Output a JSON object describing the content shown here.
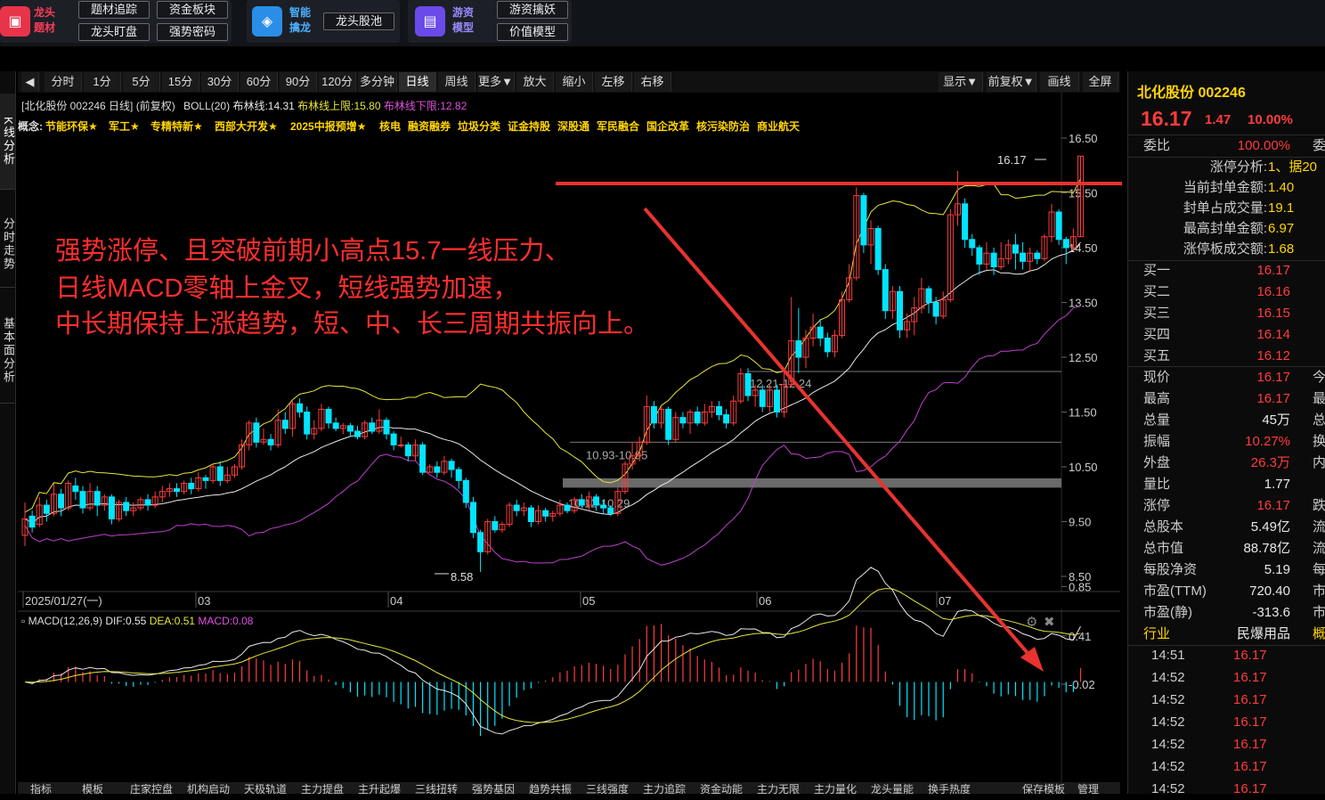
{
  "topbar": {
    "group1": {
      "title_line1": "龙头",
      "title_line2": "题材",
      "buttons": [
        "题材追踪",
        "资金板块",
        "龙头盯盘",
        "强势密码"
      ]
    },
    "group2": {
      "title_line1": "智能",
      "title_line2": "擒龙",
      "buttons": [
        "龙头股池"
      ]
    },
    "group3": {
      "title_line1": "游资",
      "title_line2": "模型",
      "buttons": [
        "游资擒妖",
        "价值模型"
      ]
    }
  },
  "left_rail": [
    "K线分析",
    "分时走势",
    "基本面分析"
  ],
  "toolbar": {
    "periods": [
      "分时",
      "1分",
      "5分",
      "15分",
      "30分",
      "60分",
      "90分",
      "120分",
      "多分钟",
      "日线",
      "周线",
      "更多▼",
      "放大",
      "缩小",
      "左移",
      "右移"
    ],
    "active": "日线",
    "right": [
      "显示▼",
      "前复权▼",
      "画线",
      "全屏"
    ]
  },
  "chart_header": {
    "title": "[北化股份 002246 日线] (前复权)",
    "boll_label": "BOLL(20)",
    "boll_mid": "布林线:14.31",
    "boll_upper": "布林线上限:15.80",
    "boll_lower": "布林线下限:12.82",
    "concepts_label": "概念:",
    "concepts": [
      "节能环保★",
      "军工★",
      "专精特新★",
      "西部大开发★",
      "2025中报预增★",
      "核电",
      "融资融券",
      "垃圾分类",
      "证金持股",
      "深股通",
      "军民融合",
      "国企改革",
      "核污染防治",
      "商业航天"
    ]
  },
  "annotation": [
    "强势涨停、且突破前期小高点15.7一线压力、",
    "日线MACD零轴上金叉，短线强势加速，",
    "中长期保持上涨趋势，短、中、长三周期共振向上。"
  ],
  "chart_data": {
    "type": "candlestick",
    "price_axis_ticks": [
      "16.50",
      "15.50",
      "14.50",
      "13.50",
      "12.50",
      "11.50",
      "10.50",
      "9.50",
      "8.50"
    ],
    "ylim": [
      8.5,
      16.5
    ],
    "date_labels": [
      "2025/01/27(一)",
      "03",
      "04",
      "05",
      "06",
      "07"
    ],
    "price_labels": [
      "16.17",
      "8.58",
      "12.21-12.24",
      "10.93-10.95",
      "10.12-10.29"
    ],
    "resistance_level": 15.7,
    "zones": [
      {
        "label": "12.21-12.24",
        "low": 12.21,
        "high": 12.24
      },
      {
        "label": "10.93-10.95",
        "low": 10.93,
        "high": 10.95
      },
      {
        "label": "10.12-10.29",
        "low": 10.12,
        "high": 10.29
      }
    ],
    "candles": [
      [
        9.25,
        9.55,
        9.85,
        9.05
      ],
      [
        9.6,
        9.4,
        9.7,
        9.3
      ],
      [
        9.45,
        9.8,
        9.95,
        9.4
      ],
      [
        9.8,
        9.65,
        9.9,
        9.5
      ],
      [
        9.65,
        10.0,
        10.2,
        9.6
      ],
      [
        10.0,
        9.75,
        10.1,
        9.6
      ],
      [
        9.75,
        10.2,
        10.25,
        9.7
      ],
      [
        10.15,
        10.05,
        10.3,
        9.9
      ],
      [
        10.05,
        9.75,
        10.15,
        9.65
      ],
      [
        9.75,
        10.05,
        10.2,
        9.7
      ],
      [
        10.05,
        9.8,
        10.15,
        9.6
      ],
      [
        9.8,
        9.95,
        10.0,
        9.7
      ],
      [
        9.95,
        9.55,
        10.0,
        9.45
      ],
      [
        9.55,
        9.85,
        9.9,
        9.5
      ],
      [
        9.85,
        9.7,
        9.95,
        9.6
      ],
      [
        9.7,
        9.75,
        9.85,
        9.6
      ],
      [
        9.75,
        9.9,
        9.95,
        9.7
      ],
      [
        9.9,
        9.8,
        10.0,
        9.7
      ],
      [
        9.8,
        9.95,
        10.05,
        9.75
      ],
      [
        9.95,
        10.05,
        10.15,
        9.85
      ],
      [
        10.05,
        10.1,
        10.2,
        9.95
      ],
      [
        10.1,
        10.05,
        10.2,
        9.95
      ],
      [
        10.05,
        10.2,
        10.25,
        10.0
      ],
      [
        10.2,
        10.1,
        10.3,
        10.0
      ],
      [
        10.1,
        10.3,
        10.4,
        10.05
      ],
      [
        10.3,
        10.25,
        10.35,
        10.1
      ],
      [
        10.25,
        10.5,
        10.55,
        10.2
      ],
      [
        10.5,
        10.25,
        10.6,
        10.15
      ],
      [
        10.25,
        10.35,
        10.5,
        10.2
      ],
      [
        10.35,
        10.5,
        10.55,
        10.3
      ],
      [
        10.5,
        10.9,
        11.0,
        10.45
      ],
      [
        10.9,
        11.3,
        11.35,
        10.8
      ],
      [
        11.3,
        10.95,
        11.4,
        10.85
      ],
      [
        10.95,
        11.0,
        11.2,
        10.9
      ],
      [
        11.0,
        10.9,
        11.1,
        10.8
      ],
      [
        10.9,
        11.35,
        11.55,
        10.85
      ],
      [
        11.35,
        11.2,
        11.5,
        11.1
      ],
      [
        11.2,
        11.65,
        11.7,
        11.05
      ],
      [
        11.65,
        11.5,
        11.75,
        11.4
      ],
      [
        11.5,
        11.1,
        11.6,
        11.0
      ],
      [
        11.1,
        11.2,
        11.35,
        11.0
      ],
      [
        11.2,
        11.55,
        11.65,
        11.15
      ],
      [
        11.55,
        11.3,
        11.6,
        11.2
      ],
      [
        11.3,
        11.2,
        11.4,
        11.15
      ],
      [
        11.2,
        11.25,
        11.3,
        11.1
      ],
      [
        11.25,
        11.15,
        11.3,
        11.05
      ],
      [
        11.15,
        11.05,
        11.25,
        11.0
      ],
      [
        11.05,
        11.3,
        11.35,
        11.0
      ],
      [
        11.3,
        11.15,
        11.4,
        11.1
      ],
      [
        11.15,
        11.35,
        11.55,
        11.1
      ],
      [
        11.35,
        11.1,
        11.4,
        11.0
      ],
      [
        11.1,
        10.9,
        11.15,
        10.8
      ],
      [
        10.9,
        10.9,
        11.05,
        10.85
      ],
      [
        10.9,
        10.7,
        10.95,
        10.6
      ],
      [
        10.7,
        10.9,
        11.0,
        10.6
      ],
      [
        10.9,
        10.4,
        10.95,
        10.35
      ],
      [
        10.4,
        10.5,
        10.55,
        10.4
      ],
      [
        10.5,
        10.4,
        10.6,
        10.3
      ],
      [
        10.4,
        10.6,
        10.7,
        10.35
      ],
      [
        10.6,
        10.45,
        10.65,
        10.3
      ],
      [
        10.45,
        10.25,
        10.5,
        10.1
      ],
      [
        10.25,
        9.85,
        10.3,
        9.75
      ],
      [
        9.85,
        9.3,
        9.95,
        9.2
      ],
      [
        9.3,
        8.95,
        9.35,
        8.58
      ],
      [
        8.95,
        9.5,
        9.55,
        8.9
      ],
      [
        9.5,
        9.35,
        9.6,
        9.3
      ],
      [
        9.35,
        9.45,
        9.5,
        9.3
      ],
      [
        9.45,
        9.8,
        9.85,
        9.4
      ],
      [
        9.8,
        9.7,
        9.9,
        9.6
      ],
      [
        9.7,
        9.75,
        9.85,
        9.6
      ],
      [
        9.75,
        9.5,
        9.8,
        9.4
      ],
      [
        9.5,
        9.7,
        9.8,
        9.45
      ],
      [
        9.7,
        9.6,
        9.75,
        9.5
      ],
      [
        9.6,
        9.65,
        9.7,
        9.5
      ],
      [
        9.65,
        9.8,
        9.9,
        9.6
      ],
      [
        9.8,
        9.7,
        9.85,
        9.65
      ],
      [
        9.7,
        9.9,
        9.95,
        9.65
      ],
      [
        9.9,
        9.8,
        10.0,
        9.75
      ],
      [
        9.8,
        9.95,
        10.05,
        9.7
      ],
      [
        9.95,
        9.8,
        10.0,
        9.7
      ],
      [
        9.8,
        9.75,
        9.9,
        9.65
      ],
      [
        9.75,
        9.65,
        9.8,
        9.6
      ],
      [
        9.65,
        10.05,
        10.12,
        9.6
      ],
      [
        10.05,
        10.55,
        10.6,
        10.0
      ],
      [
        10.55,
        10.7,
        10.95,
        10.45
      ],
      [
        10.7,
        10.95,
        11.05,
        10.6
      ],
      [
        10.95,
        11.6,
        11.8,
        10.9
      ],
      [
        11.6,
        11.3,
        11.7,
        11.2
      ],
      [
        11.3,
        11.55,
        11.6,
        11.2
      ],
      [
        11.55,
        11.0,
        11.6,
        10.9
      ],
      [
        11.0,
        11.4,
        11.5,
        10.95
      ],
      [
        11.4,
        11.3,
        11.5,
        11.2
      ],
      [
        11.3,
        11.5,
        11.55,
        11.1
      ],
      [
        11.5,
        11.3,
        11.6,
        11.25
      ],
      [
        11.3,
        11.5,
        11.65,
        11.25
      ],
      [
        11.5,
        11.6,
        11.7,
        11.4
      ],
      [
        11.6,
        11.45,
        11.7,
        11.35
      ],
      [
        11.45,
        11.3,
        11.55,
        11.2
      ],
      [
        11.3,
        11.7,
        11.8,
        11.25
      ],
      [
        11.7,
        12.2,
        12.3,
        11.65
      ],
      [
        12.2,
        11.8,
        12.3,
        11.7
      ],
      [
        11.8,
        11.9,
        12.0,
        11.6
      ],
      [
        11.9,
        11.6,
        12.0,
        11.5
      ],
      [
        11.6,
        11.9,
        12.0,
        11.5
      ],
      [
        11.9,
        11.5,
        12.0,
        11.4
      ],
      [
        11.5,
        12.0,
        12.24,
        11.4
      ],
      [
        12.0,
        12.8,
        13.6,
        11.95
      ],
      [
        12.8,
        12.5,
        13.4,
        12.21
      ],
      [
        12.5,
        12.85,
        13.0,
        12.3
      ],
      [
        12.85,
        13.05,
        13.3,
        12.7
      ],
      [
        13.05,
        12.85,
        13.2,
        12.7
      ],
      [
        12.85,
        12.6,
        12.95,
        12.5
      ],
      [
        12.6,
        12.9,
        13.0,
        12.5
      ],
      [
        12.9,
        13.55,
        13.7,
        12.85
      ],
      [
        13.55,
        13.95,
        14.2,
        13.5
      ],
      [
        13.95,
        15.45,
        15.6,
        13.9
      ],
      [
        15.45,
        14.55,
        15.5,
        14.4
      ],
      [
        14.55,
        14.85,
        15.0,
        14.2
      ],
      [
        14.85,
        14.1,
        14.9,
        14.0
      ],
      [
        14.1,
        13.35,
        14.2,
        13.2
      ],
      [
        13.35,
        13.7,
        13.8,
        13.2
      ],
      [
        13.7,
        13.0,
        13.8,
        12.85
      ],
      [
        13.0,
        13.15,
        13.3,
        12.85
      ],
      [
        13.15,
        13.4,
        13.6,
        12.9
      ],
      [
        13.4,
        13.75,
        13.95,
        13.3
      ],
      [
        13.75,
        13.5,
        13.8,
        13.3
      ],
      [
        13.5,
        13.25,
        13.6,
        13.1
      ],
      [
        13.25,
        13.55,
        13.7,
        13.2
      ],
      [
        13.55,
        15.1,
        15.2,
        13.5
      ],
      [
        15.1,
        15.3,
        15.9,
        14.9
      ],
      [
        15.3,
        14.65,
        15.4,
        14.5
      ],
      [
        14.65,
        14.5,
        14.75,
        14.35
      ],
      [
        14.5,
        14.2,
        14.55,
        14.0
      ],
      [
        14.2,
        14.4,
        14.6,
        14.1
      ],
      [
        14.4,
        14.15,
        14.5,
        14.0
      ],
      [
        14.15,
        14.3,
        14.6,
        14.1
      ],
      [
        14.3,
        14.55,
        14.65,
        14.2
      ],
      [
        14.55,
        14.4,
        14.75,
        14.1
      ],
      [
        14.4,
        14.25,
        14.6,
        14.1
      ],
      [
        14.25,
        14.4,
        14.5,
        14.05
      ],
      [
        14.4,
        14.3,
        14.45,
        14.2
      ],
      [
        14.3,
        14.7,
        14.75,
        14.25
      ],
      [
        14.7,
        15.15,
        15.3,
        14.6
      ],
      [
        15.15,
        14.65,
        15.2,
        14.55
      ],
      [
        14.65,
        14.5,
        14.7,
        14.2
      ],
      [
        14.5,
        14.7,
        14.85,
        14.45
      ],
      [
        14.7,
        16.17,
        16.17,
        14.7
      ]
    ],
    "macd": {
      "label": "MACD(12,26,9)",
      "dif_label": "DIF:0.55",
      "dea_label": "DEA:0.51",
      "macd_label": "MACD:0.08",
      "dif": 0.55,
      "dea": 0.51,
      "macd": 0.08,
      "axis_ticks": [
        "0.85",
        "0.41",
        "-0.02"
      ]
    }
  },
  "quote": {
    "name": "北化股份 002246",
    "price": "16.17",
    "change": "1.47",
    "change_pct": "10.00%",
    "weibi_label": "委比",
    "weibi": "100.00%",
    "weicha_label": "委差",
    "limit_analysis": [
      {
        "label": "涨停分析:",
        "value": "1、据20"
      },
      {
        "label": "当前封单金额:",
        "value": "1.40"
      },
      {
        "label": "封单占成交量:",
        "value": "19.1"
      },
      {
        "label": "最高封单金额:",
        "value": "6.97"
      },
      {
        "label": "涨停板成交额:",
        "value": "1.68"
      }
    ],
    "bids": [
      {
        "label": "买一",
        "price": "16.17"
      },
      {
        "label": "买二",
        "price": "16.16"
      },
      {
        "label": "买三",
        "price": "16.15"
      },
      {
        "label": "买四",
        "price": "16.14"
      },
      {
        "label": "买五",
        "price": "16.12"
      }
    ],
    "stats": [
      {
        "label": "现价",
        "value": "16.17",
        "cls": "red",
        "extra": "今"
      },
      {
        "label": "最高",
        "value": "16.17",
        "cls": "red",
        "extra": "最"
      },
      {
        "label": "总量",
        "value": "45万",
        "cls": "wht",
        "extra": "总"
      },
      {
        "label": "振幅",
        "value": "10.27%",
        "cls": "red",
        "extra": "换"
      },
      {
        "label": "外盘",
        "value": "26.3万",
        "cls": "red",
        "extra": "内"
      },
      {
        "label": "量比",
        "value": "1.77",
        "cls": "wht",
        "extra": ""
      },
      {
        "label": "涨停",
        "value": "16.17",
        "cls": "red",
        "extra": "跌"
      },
      {
        "label": "总股本",
        "value": "5.49亿",
        "cls": "wht",
        "extra": "流"
      },
      {
        "label": "总市值",
        "value": "88.78亿",
        "cls": "wht",
        "extra": "流"
      },
      {
        "label": "每股净资",
        "value": "5.19",
        "cls": "wht",
        "extra": "每"
      },
      {
        "label": "市盈(TTM)",
        "value": "720.40",
        "cls": "wht",
        "extra": "市"
      },
      {
        "label": "市盈(静)",
        "value": "-313.6",
        "cls": "wht",
        "extra": "市"
      }
    ],
    "industry_label": "行业",
    "industry": "民爆用品",
    "industry_extra": "概",
    "ticks": [
      {
        "time": "14:51",
        "price": "16.17"
      },
      {
        "time": "14:52",
        "price": "16.17"
      },
      {
        "time": "14:52",
        "price": "16.17"
      },
      {
        "time": "14:52",
        "price": "16.17"
      },
      {
        "time": "14:52",
        "price": "16.17"
      },
      {
        "time": "14:52",
        "price": "16.17"
      },
      {
        "time": "14:52",
        "price": "16.17"
      }
    ]
  },
  "bottom_tabs": [
    "指标",
    "模板",
    "庄家控盘",
    "机构启动",
    "天极轨道",
    "主力提盘",
    "主升起爆",
    "三线扭转",
    "强势基因",
    "趋势共振",
    "三线强度",
    "主力追踪",
    "资金动能",
    "主力无限",
    "主力量化",
    "龙头量能",
    "换手热度",
    "保存模板",
    "管理"
  ],
  "colors": {
    "up": "#ff3c3c",
    "down": "#00e5ff",
    "boll_upper": "#e6e63c",
    "boll_mid": "#e8e8e8",
    "boll_lower": "#c040d0",
    "annotation": "#ff2e2e"
  }
}
